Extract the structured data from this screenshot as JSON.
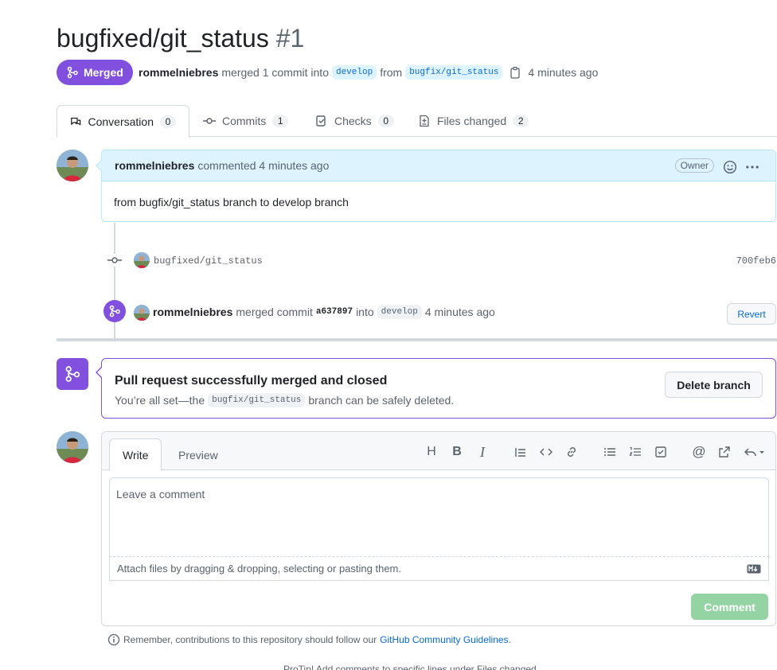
{
  "pr": {
    "title": "bugfixed/git_status",
    "number": "#1",
    "state_label": "Merged",
    "author": "rommelniebres",
    "merged_text": "merged 1 commit into",
    "base_branch": "develop",
    "from_text": "from",
    "head_branch": "bugfix/git_status",
    "time": "4 minutes ago"
  },
  "tabs": [
    {
      "label": "Conversation",
      "count": "0"
    },
    {
      "label": "Commits",
      "count": "1"
    },
    {
      "label": "Checks",
      "count": "0"
    },
    {
      "label": "Files changed",
      "count": "2"
    }
  ],
  "comment": {
    "author": "rommelniebres",
    "meta": "commented 4 minutes ago",
    "badge": "Owner",
    "body": "from bugfix/git_status branch to develop branch"
  },
  "commit": {
    "message": "bugfixed/git_status",
    "sha": "700feb6"
  },
  "merge_event": {
    "author": "rommelniebres",
    "text1": "merged commit",
    "sha": "a637897",
    "text2": "into",
    "branch": "develop",
    "time": "4 minutes ago",
    "revert_label": "Revert"
  },
  "merged_box": {
    "heading": "Pull request successfully merged and closed",
    "sub_before": "You’re all set—the",
    "branch": "bugfix/git_status",
    "sub_after": "branch can be safely deleted.",
    "delete_label": "Delete branch"
  },
  "editor": {
    "write_tab": "Write",
    "preview_tab": "Preview",
    "placeholder": "Leave a comment",
    "attach_text": "Attach files by dragging & dropping, selecting or pasting them.",
    "submit_label": "Comment",
    "toolbar_icons": [
      "heading-icon",
      "bold-icon",
      "italic-icon",
      "quote-icon",
      "code-icon",
      "link-icon",
      "unordered-list-icon",
      "ordered-list-icon",
      "task-list-icon",
      "mention-icon",
      "reference-icon",
      "reply-icon"
    ]
  },
  "footer": {
    "guidelines_text": "Remember, contributions to this repository should follow our",
    "guidelines_link": "GitHub Community Guidelines",
    "guidelines_end": ".",
    "protip": "ProTip! Add comments to specific lines under Files changed."
  },
  "colors": {
    "merged_purple": "#8250df",
    "link_blue": "#0969da",
    "comment_header_bg": "#ddf4ff",
    "disabled_green": "#94d3a2"
  }
}
